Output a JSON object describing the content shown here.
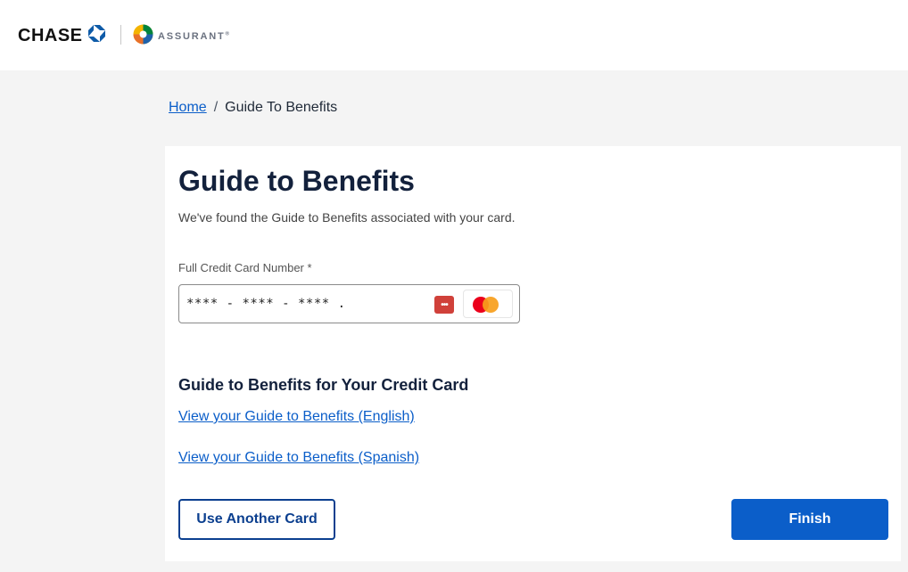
{
  "header": {
    "chase_logo_text": "CHASE",
    "assurant_logo_text": "ASSURANT",
    "assurant_trademark": "®"
  },
  "breadcrumb": {
    "home": "Home",
    "separator": "/",
    "current": "Guide To Benefits"
  },
  "main": {
    "title": "Guide to Benefits",
    "subtitle": "We've found the Guide to Benefits associated with your card.",
    "card_field": {
      "label": "Full Credit Card Number *",
      "value": "**** - **** - **** .",
      "password_manager_icon": "password-manager-icon",
      "card_brand_icon": "mastercard-icon"
    },
    "section_heading": "Guide to Benefits for Your Credit Card",
    "links": {
      "english": "View your Guide to Benefits (English)",
      "spanish": "View your Guide to Benefits (Spanish)"
    },
    "buttons": {
      "use_another_card": "Use Another Card",
      "finish": "Finish"
    }
  },
  "colors": {
    "brand_blue": "#0b5ec9",
    "dark_navy": "#13213c",
    "page_background": "#f4f4f4"
  }
}
